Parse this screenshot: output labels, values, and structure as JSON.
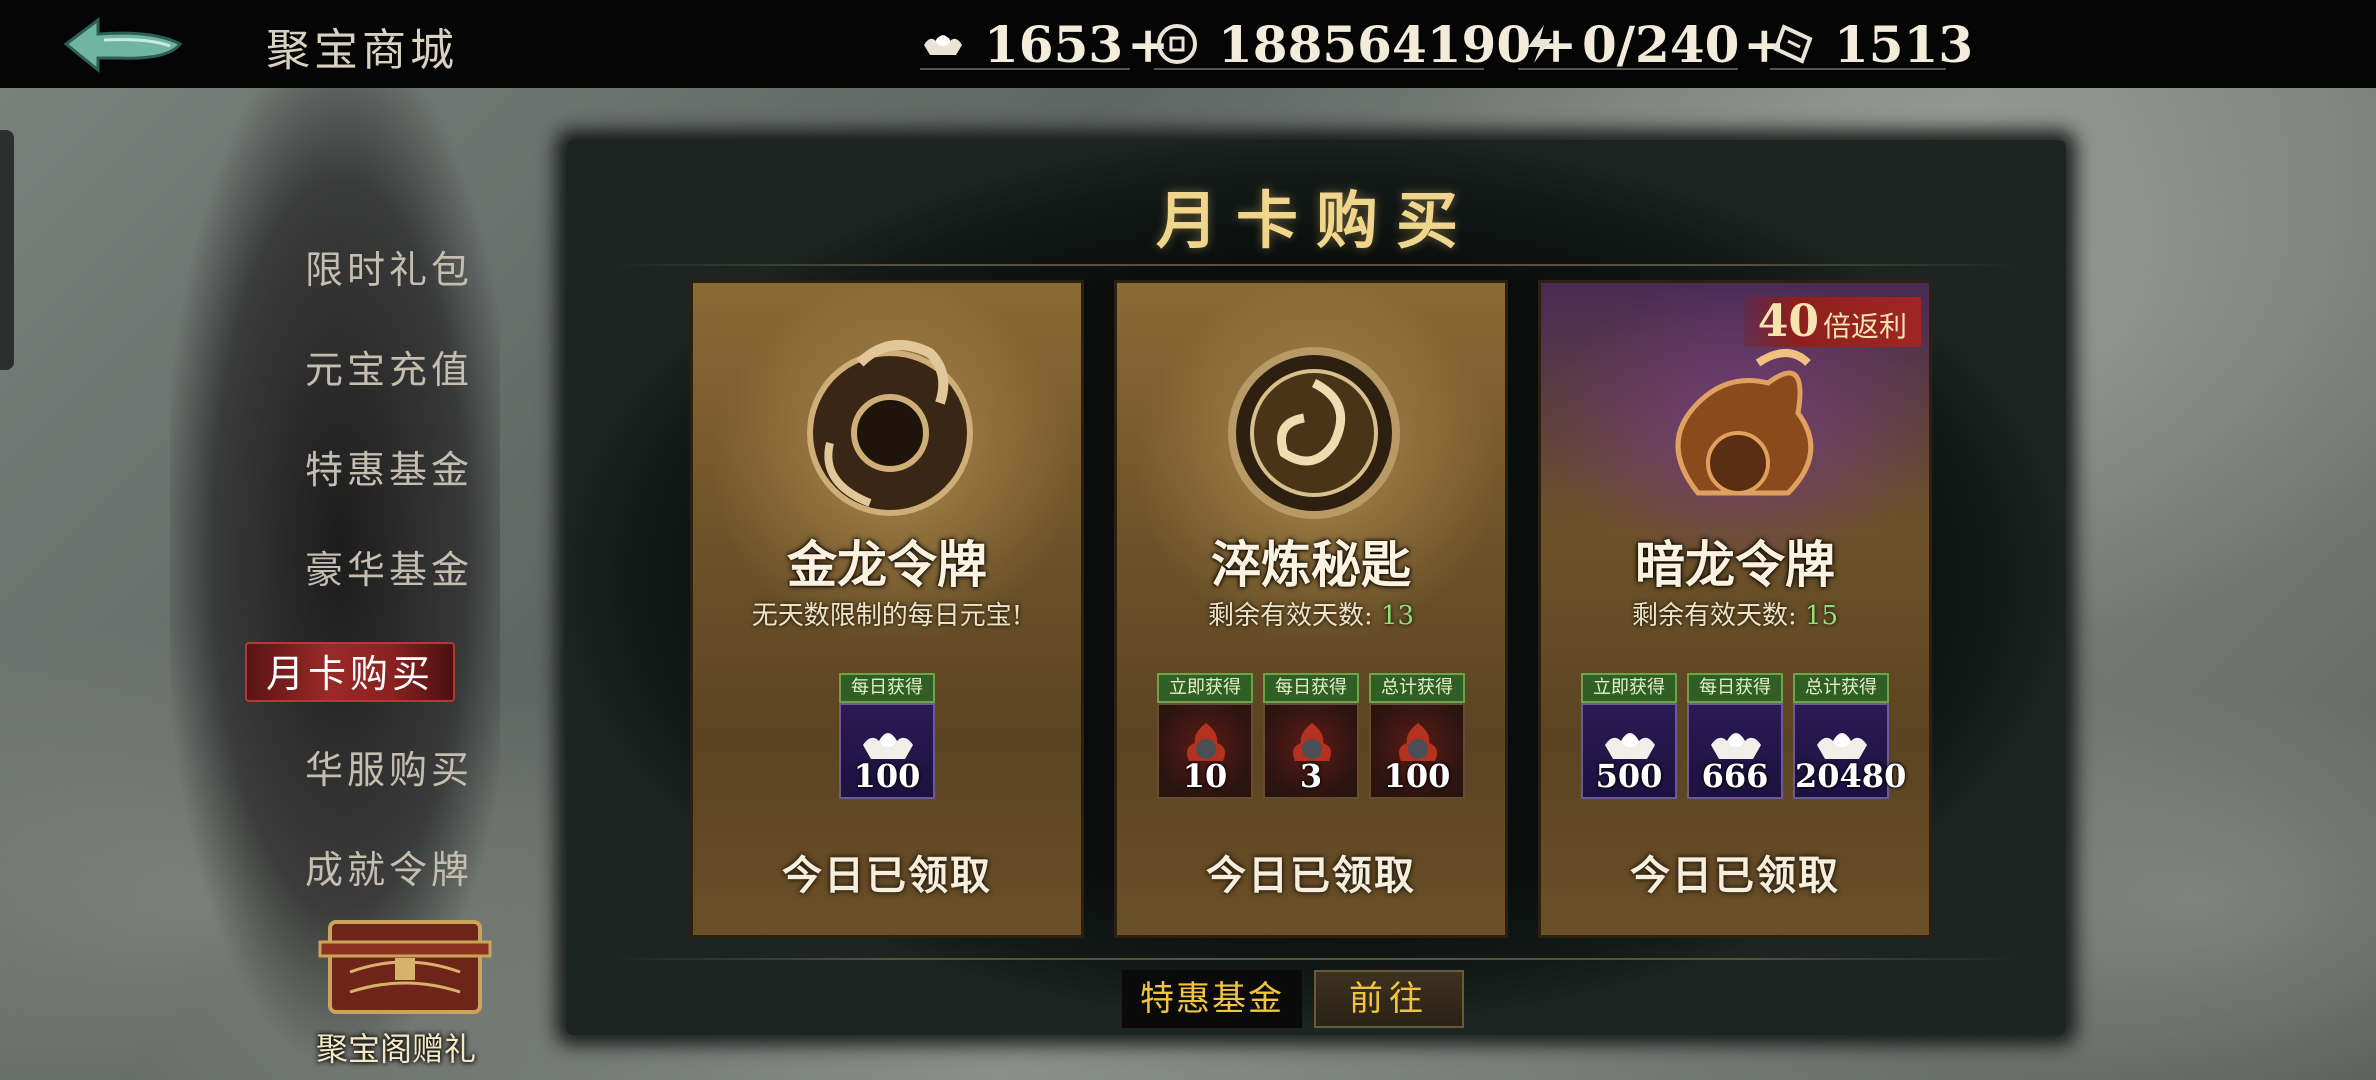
{
  "header": {
    "title": "聚宝商城",
    "resources": [
      {
        "icon": "ingot-icon",
        "value": "1653",
        "plus": "+"
      },
      {
        "icon": "coin-icon",
        "value": "188564190",
        "plus": "+"
      },
      {
        "icon": "stamina-icon",
        "value": "0/240",
        "plus": "+"
      },
      {
        "icon": "ticket-icon",
        "value": "1513",
        "plus": ""
      }
    ]
  },
  "sidebar": {
    "items": [
      {
        "label": "限时礼包"
      },
      {
        "label": "元宝充值"
      },
      {
        "label": "特惠基金"
      },
      {
        "label": "豪华基金"
      },
      {
        "label": "月卡购买",
        "active": true
      },
      {
        "label": "华服购买"
      },
      {
        "label": "成就令牌"
      }
    ],
    "gift_label": "聚宝阁赠礼"
  },
  "panel": {
    "title": "月卡购买",
    "cards": [
      {
        "name": "金龙令牌",
        "desc": "无天数限制的每日元宝!",
        "rewards": [
          {
            "tag": "每日获得",
            "icon": "ingot-icon",
            "count": "100"
          }
        ],
        "claim": "今日已领取"
      },
      {
        "name": "淬炼秘匙",
        "desc_prefix": "剩余有效天数:",
        "days": "13",
        "rewards": [
          {
            "tag": "立即获得",
            "icon": "fire-orb-icon",
            "count": "10"
          },
          {
            "tag": "每日获得",
            "icon": "fire-orb-icon",
            "count": "3"
          },
          {
            "tag": "总计获得",
            "icon": "fire-orb-icon",
            "count": "100"
          }
        ],
        "claim": "今日已领取"
      },
      {
        "name": "暗龙令牌",
        "desc_prefix": "剩余有效天数:",
        "days": "15",
        "bonus_num": "40",
        "bonus_text": "倍返利",
        "rewards": [
          {
            "tag": "立即获得",
            "icon": "ingot-icon",
            "count": "500"
          },
          {
            "tag": "每日获得",
            "icon": "ingot-icon",
            "count": "666"
          },
          {
            "tag": "总计获得",
            "icon": "ingot-icon",
            "count": "20480"
          }
        ],
        "claim": "今日已领取"
      }
    ],
    "footer_label": "特惠基金",
    "goto_label": "前往"
  },
  "colors": {
    "accent_gold": "#f0d68c",
    "active_red": "#9a2a28",
    "green_days": "#8fe07a"
  }
}
